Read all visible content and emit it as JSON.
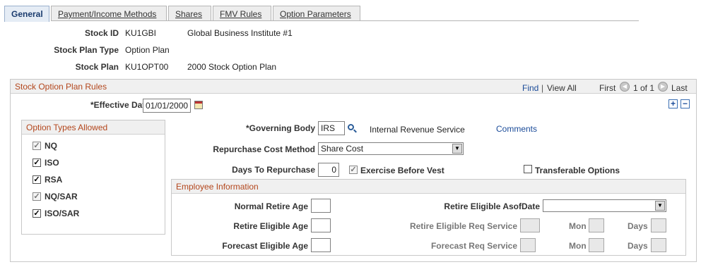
{
  "tabs": [
    {
      "label": "General"
    },
    {
      "label": "Payment/Income Methods"
    },
    {
      "label": "Shares"
    },
    {
      "label": "FMV Rules"
    },
    {
      "label": "Option Parameters"
    }
  ],
  "header": {
    "stock_id_label": "Stock ID",
    "stock_id_value": "KU1GBI",
    "stock_id_desc": "Global Business Institute #1",
    "plan_type_label": "Stock Plan Type",
    "plan_type_value": "Option Plan",
    "stock_plan_label": "Stock Plan",
    "stock_plan_value": "KU1OPT00",
    "stock_plan_desc": "2000 Stock Option Plan"
  },
  "rules": {
    "title": "Stock Option Plan Rules",
    "find": "Find",
    "sep": "|",
    "view_all": "View All",
    "first": "First",
    "position": "1 of 1",
    "last": "Last",
    "add_symbol": "+",
    "remove_symbol": "−",
    "effective_date_label": "*Effective Date",
    "effective_date_value": "01/01/2000"
  },
  "option_types": {
    "title": "Option Types Allowed",
    "items": [
      {
        "label": "NQ",
        "checked": true,
        "disabled": true
      },
      {
        "label": "ISO",
        "checked": true,
        "disabled": false
      },
      {
        "label": "RSA",
        "checked": true,
        "disabled": false
      },
      {
        "label": "NQ/SAR",
        "checked": true,
        "disabled": true
      },
      {
        "label": "ISO/SAR",
        "checked": true,
        "disabled": false
      }
    ]
  },
  "plan_fields": {
    "governing_body_label": "*Governing Body",
    "governing_body_value": "IRS",
    "governing_body_desc": "Internal Revenue Service",
    "comments_link": "Comments",
    "repurchase_method_label": "Repurchase Cost Method",
    "repurchase_method_value": "Share Cost",
    "days_to_repurchase_label": "Days To Repurchase",
    "days_to_repurchase_value": "0",
    "exercise_before_vest_label": "Exercise Before Vest",
    "transferable_label": "Transferable Options"
  },
  "employee_info": {
    "title": "Employee Information",
    "normal_retire_age_label": "Normal Retire Age",
    "retire_eligible_age_label": "Retire Eligible Age",
    "forecast_eligible_age_label": "Forecast Eligible Age",
    "retire_eligible_asof_label": "Retire Eligible AsofDate",
    "retire_eligible_req_service_label": "Retire Eligible Req Service",
    "forecast_req_service_label": "Forecast Req Service",
    "mon_label": "Mon",
    "days_label": "Days"
  },
  "colors": {
    "section_title": "#b3461c",
    "link": "#1a4b99"
  }
}
